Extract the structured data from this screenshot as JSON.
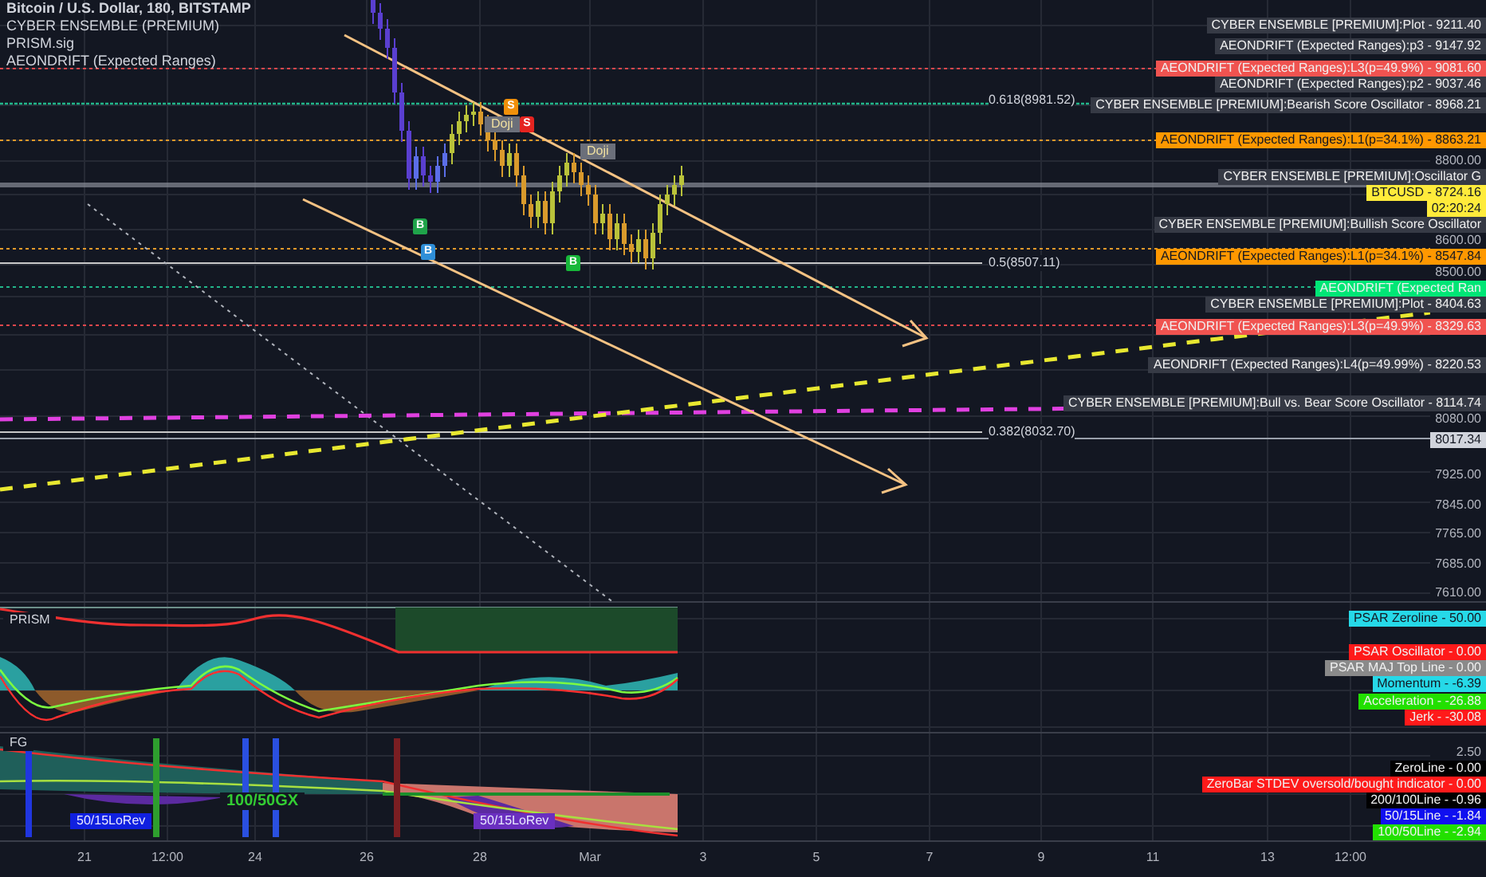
{
  "legend": [
    "Bitcoin / U.S. Dollar, 180, BITSTAMP",
    "CYBER ENSEMBLE (PREMIUM)",
    "PRISM.sig",
    "AEONDRIFT (Expected Ranges)"
  ],
  "main_pane": {
    "fib_levels": [
      "0.618(8981.52)",
      "0.5(8507.11)",
      "0.382(8032.70)"
    ],
    "pattern_labels": [
      "Doji",
      "Doji"
    ],
    "signals": [
      {
        "text": "B",
        "color": "#1fa34a"
      },
      {
        "text": "B",
        "color": "#2f8fd8"
      },
      {
        "text": "S",
        "color": "#f0900a"
      },
      {
        "text": "S",
        "color": "#e52420"
      },
      {
        "text": "B",
        "color": "#18b83a"
      }
    ],
    "price_scale": [
      {
        "kind": "label",
        "text": "CYBER ENSEMBLE [PREMIUM]:Plot - 9211.40",
        "color": "#363a45"
      },
      {
        "kind": "label",
        "text": "AEONDRIFT (Expected Ranges):p3 - 9147.92",
        "color": "#363a45"
      },
      {
        "kind": "label",
        "text": "AEONDRIFT (Expected Ranges):L3(p=49.9%) - 9081.60",
        "color": "#f05350"
      },
      {
        "kind": "label",
        "text": "AEONDRIFT (Expected Ranges):p2 - 9037.46",
        "color": "#363a45"
      },
      {
        "kind": "label",
        "text": "CYBER ENSEMBLE [PREMIUM]:Bearish Score Oscillator - 8968.21",
        "color": "#363a45"
      },
      {
        "kind": "label",
        "text": "AEONDRIFT (Expected Ranges):L1(p=34.1%) - 8863.21",
        "color": "#ff9800"
      },
      {
        "kind": "tick",
        "text": "8800.00"
      },
      {
        "kind": "label",
        "text": "CYBER ENSEMBLE [PREMIUM]:Oscillator G",
        "color": "#363a45"
      },
      {
        "kind": "label",
        "text": "BTCUSD - 8724.16",
        "color": "#ffeb3b"
      },
      {
        "kind": "label",
        "text": "02:20:24",
        "color": "#ffeb3b"
      },
      {
        "kind": "label",
        "text": "CYBER ENSEMBLE [PREMIUM]:Bullish Score Oscillator",
        "color": "#363a45"
      },
      {
        "kind": "tick",
        "text": "8600.00"
      },
      {
        "kind": "label",
        "text": "AEONDRIFT (Expected Ranges):L1(p=34.1%) - 8547.84",
        "color": "#ff9800"
      },
      {
        "kind": "tick",
        "text": "8500.00"
      },
      {
        "kind": "label",
        "text": "AEONDRIFT (Expected Ran",
        "color": "#00e676"
      },
      {
        "kind": "label",
        "text": "CYBER ENSEMBLE [PREMIUM]:Plot - 8404.63",
        "color": "#363a45"
      },
      {
        "kind": "label",
        "text": "AEONDRIFT (Expected Ranges):L3(p=49.9%) - 8329.63",
        "color": "#f05350"
      },
      {
        "kind": "label",
        "text": "AEONDRIFT (Expected Ranges):L4(p=49.99%) - 8220.53",
        "color": "#363a45"
      },
      {
        "kind": "label",
        "text": "CYBER ENSEMBLE [PREMIUM]:Bull vs. Bear Score Oscillator - 8114.74",
        "color": "#363a45"
      },
      {
        "kind": "tick",
        "text": "8080.00"
      },
      {
        "kind": "label",
        "text": "8017.34",
        "color": "#d1d4dc"
      },
      {
        "kind": "tick",
        "text": "7925.00"
      },
      {
        "kind": "tick",
        "text": "7845.00"
      },
      {
        "kind": "tick",
        "text": "7765.00"
      },
      {
        "kind": "tick",
        "text": "7685.00"
      },
      {
        "kind": "tick",
        "text": "7610.00"
      }
    ]
  },
  "prism_pane": {
    "title": "PRISM",
    "scale": [
      {
        "kind": "label",
        "text": "PSAR Zeroline - 50.00",
        "color": "#26d9e8"
      },
      {
        "kind": "label",
        "text": "PSAR Oscillator - 0.00",
        "color": "#ff1a1a"
      },
      {
        "kind": "label",
        "text": "PSAR MAJ Top Line - 0.00",
        "color": "#8a8a8a"
      },
      {
        "kind": "label",
        "text": "Momentum - -6.39",
        "color": "#26d9e8"
      },
      {
        "kind": "label",
        "text": "Acceleration - -26.88",
        "color": "#22e000"
      },
      {
        "kind": "label",
        "text": "Jerk - -30.08",
        "color": "#ff1a1a"
      }
    ]
  },
  "fg_pane": {
    "title": "FG",
    "annotations": [
      {
        "kind": "tag",
        "text": "50/15LoRev",
        "color": "#1020e0"
      },
      {
        "kind": "text",
        "text": "100/50GX",
        "color": "#33cc33"
      },
      {
        "kind": "tag",
        "text": "50/15LoRev",
        "color": "#6a2fc0"
      }
    ],
    "scale": [
      {
        "kind": "tick",
        "text": "2.50"
      },
      {
        "kind": "label",
        "text": "ZeroLine - 0.00",
        "color": "#000000"
      },
      {
        "kind": "label",
        "text": "ZeroBar STDEV oversold/bought indicator - 0.00",
        "color": "#ff1a1a"
      },
      {
        "kind": "label",
        "text": "200/100Line - -0.96",
        "color": "#000000"
      },
      {
        "kind": "label",
        "text": "50/15Line - -1.84",
        "color": "#1010f0"
      },
      {
        "kind": "label",
        "text": "100/50Line - -2.94",
        "color": "#22e000"
      }
    ]
  },
  "time_axis": [
    "21",
    "12:00",
    "24",
    "26",
    "28",
    "Mar",
    "3",
    "5",
    "7",
    "9",
    "11",
    "13",
    "12:00"
  ]
}
